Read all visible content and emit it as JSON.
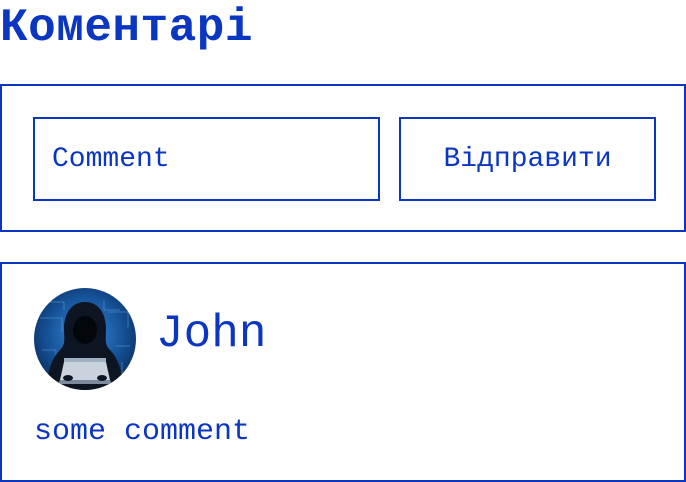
{
  "page": {
    "title": "Коментарі"
  },
  "comment_form": {
    "input_placeholder": "Comment",
    "submit_label": "Відправити"
  },
  "comments": [
    {
      "author": "John",
      "text": "some comment",
      "avatar_icon": "hooded-hacker-avatar"
    }
  ],
  "colors": {
    "accent": "#0b36c2",
    "background": "#ffffff"
  }
}
